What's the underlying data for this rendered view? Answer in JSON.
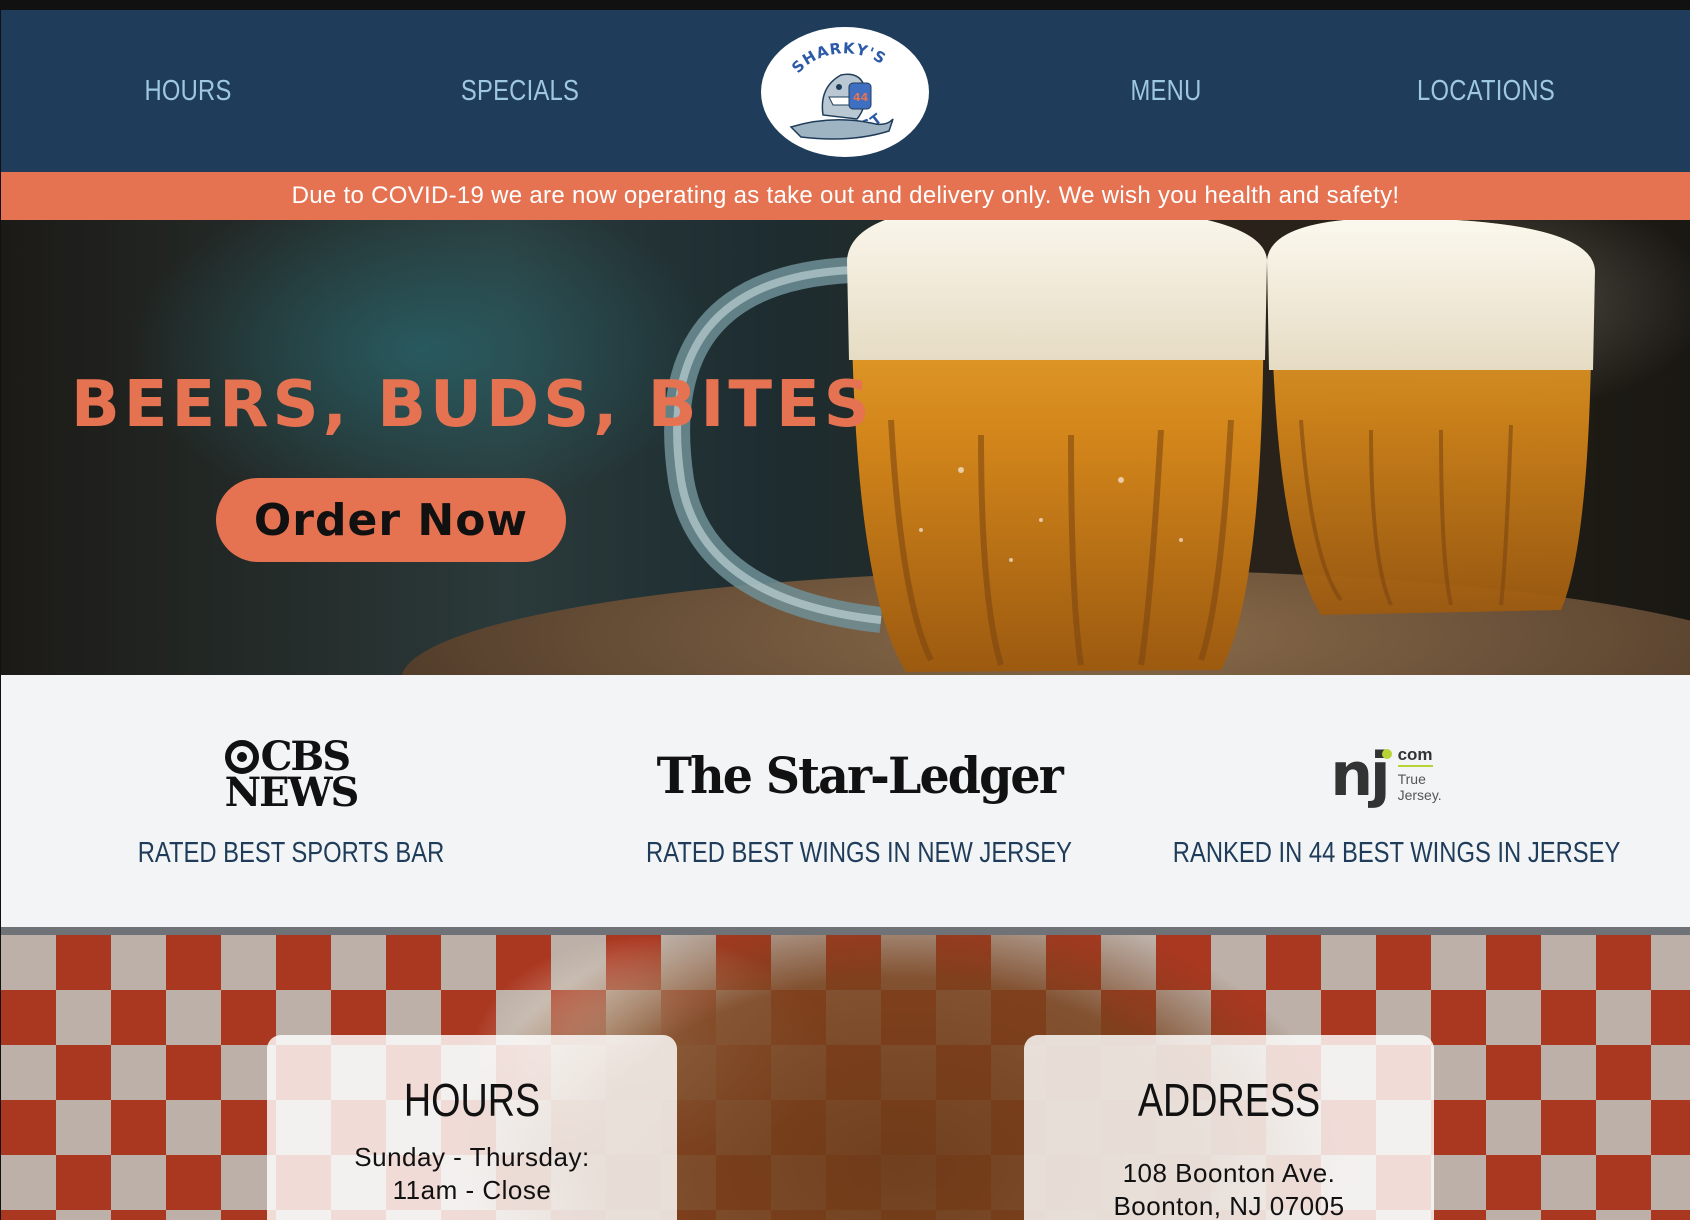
{
  "nav": {
    "links": [
      "HOURS",
      "SPECIALS",
      "MENU",
      "LOCATIONS"
    ],
    "logo": {
      "top_text": "SHARKY'S",
      "bottom_text": "WEST",
      "jersey_number": "44",
      "icon": "shark-logo-icon"
    }
  },
  "banner": {
    "text": "Due to COVID-19 we are now operating as take out and delivery only. We wish you health and safety!"
  },
  "hero": {
    "title": "BEERS, BUDS, BITES",
    "cta_label": "Order Now",
    "image": "beer-mugs-image"
  },
  "press": [
    {
      "logo_line1": "CBS",
      "logo_line2": "NEWS",
      "caption": "RATED BEST SPORTS BAR"
    },
    {
      "logo": "The Star-Ledger",
      "caption": "RATED BEST WINGS IN NEW JERSEY"
    },
    {
      "logo_mark": "nj",
      "logo_com": "com",
      "logo_tag_1": "True",
      "logo_tag_2": "Jersey.",
      "caption": "RANKED IN 44 BEST WINGS IN JERSEY"
    }
  ],
  "hours_card": {
    "title": "HOURS",
    "line1": "Sunday - Thursday:",
    "line2": "11am - Close"
  },
  "address_card": {
    "title": "ADDRESS",
    "line1": "108 Boonton Ave.",
    "line2": "Boonton, NJ 07005"
  },
  "colors": {
    "navy": "#1f3d5a",
    "accent": "#e57352",
    "nav_text": "#9ec7e2",
    "press_bg": "#f3f4f6"
  }
}
